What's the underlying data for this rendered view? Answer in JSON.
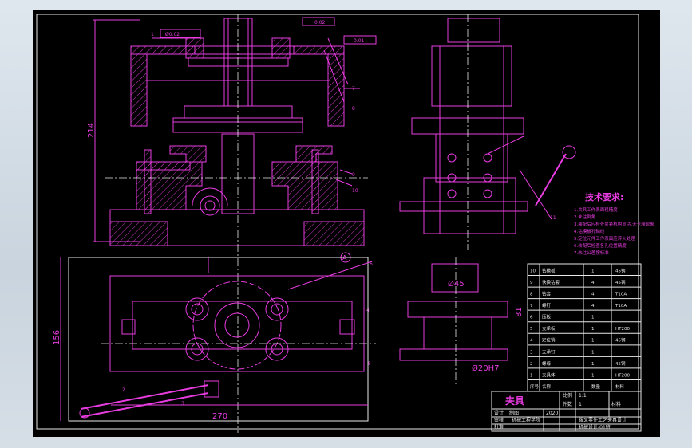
{
  "dims": {
    "height_214": "214",
    "height_156": "156",
    "width_270": "270",
    "height_81": "81"
  },
  "labels": {
    "dia45": "Ø45",
    "dia20": "Ø20H7",
    "datum_a": "A",
    "leader_nums": [
      "1",
      "2",
      "3",
      "4",
      "5",
      "6",
      "7",
      "8",
      "9",
      "10",
      "11"
    ]
  },
  "gdt": {
    "perp_top": "0.02",
    "circ_left": "Ø0.02",
    "flat_right": "0.01"
  },
  "tech_req": {
    "title": "技术要求:",
    "lines": [
      "1.夹具工作表面粗糙度",
      "2.未注倒角",
      "3.装配后应检查夹紧机构灵活,无卡滞现象",
      "4.钻模板孔轴线",
      "5.定位元件工作表面应淬火处理",
      "6.装配后检查各孔位置精度",
      "7.未注公差按标准"
    ]
  },
  "bom": {
    "rows": [
      {
        "no": "10",
        "name": "钻模板",
        "qty": "1",
        "mat": "45钢"
      },
      {
        "no": "9",
        "name": "快换钻套",
        "qty": "4",
        "mat": "45钢"
      },
      {
        "no": "8",
        "name": "钻套",
        "qty": "4",
        "mat": "T10A"
      },
      {
        "no": "7",
        "name": "螺钉",
        "qty": "4",
        "mat": "T10A"
      },
      {
        "no": "6",
        "name": "压板",
        "qty": "1",
        "mat": ""
      },
      {
        "no": "5",
        "name": "支承板",
        "qty": "1",
        "mat": "HT200"
      },
      {
        "no": "4",
        "name": "定位销",
        "qty": "1",
        "mat": "45钢"
      },
      {
        "no": "3",
        "name": "支承钉",
        "qty": "1",
        "mat": ""
      },
      {
        "no": "2",
        "name": "螺母",
        "qty": "1",
        "mat": "45钢"
      },
      {
        "no": "1",
        "name": "夹具体",
        "qty": "1",
        "mat": "HT200"
      },
      {
        "no": "序号",
        "name": "名称",
        "qty": "数量",
        "mat": "材料"
      }
    ]
  },
  "title_block": {
    "title": "夹具",
    "scale_label": "比例",
    "scale": "1:1",
    "sheet_label": "件数",
    "sheet": "1",
    "material_label": "材料",
    "designer_label": "设计",
    "checker_label": "审核",
    "approver_label": "批准",
    "drawn_label": "制图",
    "school": "机械工程学院",
    "project": "拨叉零件工艺夹具设计",
    "group": "机械设计-01班",
    "date": "2020"
  }
}
